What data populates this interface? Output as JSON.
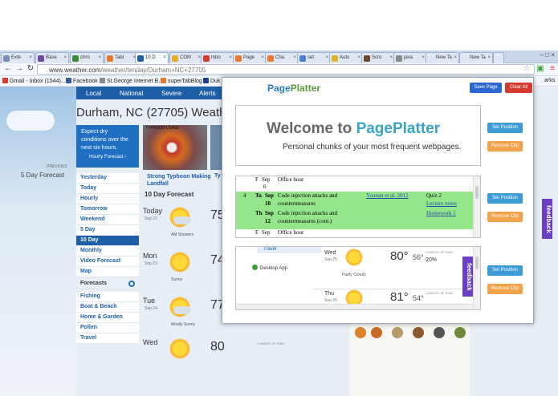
{
  "browser": {
    "tabs": [
      "Exte",
      "Base",
      "chro",
      "Tabl",
      "10 D",
      "COM",
      "Inbo",
      "Page",
      "Cha",
      "set",
      "Auto",
      "Scro",
      "java",
      "New Ta",
      "New Ta"
    ],
    "url_host": "www.weather.com",
    "url_path": "/weather/tenday/Durham+NC+27705",
    "bookmarks": [
      "Gmail - Inbox (1544)...",
      "Facebook",
      "St.George Internet B...",
      "superTabBlog",
      "Duk"
    ],
    "bookmarks_other": "arks"
  },
  "weather": {
    "nav": [
      "Local",
      "National",
      "Severe",
      "Alerts"
    ],
    "title": "Durham, NC (27705) Weathe",
    "alert_text": "Expect dry conditions over the next six hours.",
    "hourly_link": "Hourly Forecast ›",
    "news_image_label": "TYPHOON USAGI",
    "news_title": "Strong Typhoon Making Landfall",
    "news_title2": "Ty",
    "previous_label": "PREVIOUS",
    "previous_title": "5 Day Forecast",
    "menu": [
      "Yesterday",
      "Today",
      "Hourly",
      "Tomorrow",
      "Weekend",
      "5 Day",
      "10 Day",
      "Monthly",
      "Video Forecast",
      "Map"
    ],
    "forecasts_section": "Forecasts",
    "forecasts_menu": [
      "Fishing",
      "Boat & Beach",
      "Home & Garden",
      "Pollen",
      "Travel"
    ],
    "ten_day_header": "10 Day Forecast",
    "days": [
      {
        "name": "Today",
        "date": "Sep 22",
        "hi": "75",
        "cond": "AM Showers"
      },
      {
        "name": "Mon",
        "date": "Sep 23",
        "hi": "74",
        "cond": "Sunny"
      },
      {
        "name": "Tue",
        "date": "Sep 24",
        "hi": "77",
        "cond": "Mostly Sunny"
      },
      {
        "name": "Wed",
        "date": "",
        "hi": "80",
        "cond": ""
      }
    ],
    "chance_of_rain_label": "CHANCE OF RAIN"
  },
  "pageplatter": {
    "logo_a": "Page",
    "logo_b": "Platter",
    "save_page": "Save Page",
    "clear_all": "Clear All",
    "welcome_a": "Welcome to ",
    "welcome_b": "PagePlatter",
    "subtitle": "Personal chunks of your most frequent webpages.",
    "set_position": "Set Position",
    "remove_clip": "Remove Clip",
    "feedback": "feedback",
    "schedule": [
      {
        "num": "",
        "day": "F",
        "date": "Sep",
        "topic": "Office hour",
        "reading": "",
        "hw": ""
      },
      {
        "num": "",
        "day": "",
        "date": "6",
        "topic": "",
        "reading": "",
        "hw": ""
      },
      {
        "num": "4",
        "day": "Tu",
        "date": "Sep",
        "topic": "Code injection attacks and",
        "reading": "Younan et al. 2012",
        "hw": "Quiz 2"
      },
      {
        "num": "",
        "day": "",
        "date": "10",
        "topic": "countermeasures",
        "reading": "",
        "hw": "Lecture notes"
      },
      {
        "num": "",
        "day": "Th",
        "date": "Sep",
        "topic": "Code injection attacks and",
        "reading": "",
        "hw": "Homework 1"
      },
      {
        "num": "",
        "day": "",
        "date": "12",
        "topic": "countermeasures (cont.)",
        "reading": "",
        "hw": ""
      },
      {
        "num": "",
        "day": "F",
        "date": "Sep",
        "topic": "Office hour",
        "reading": "",
        "hw": ""
      }
    ],
    "clip3": {
      "travel": "Travel",
      "desktop_app": "Desktop App",
      "days": [
        {
          "name": "Wed",
          "date": "Sep 25",
          "hi": "80°",
          "lo": "56°",
          "cond": "Partly Cloudy",
          "rain_label": "CHANCE OF RAIN",
          "rain": "20%"
        },
        {
          "name": "Thu",
          "date": "Sep 26",
          "hi": "81°",
          "lo": "54°",
          "cond": "",
          "rain_label": "CHANCE OF RAIN",
          "rain": ""
        }
      ]
    }
  },
  "colors": {
    "weather_blue": "#1f5fa8",
    "save_blue": "#2a67d2",
    "clear_red": "#d63a2f",
    "clip_green": "#95e58b",
    "feedback_purple": "#6a3fc4"
  }
}
